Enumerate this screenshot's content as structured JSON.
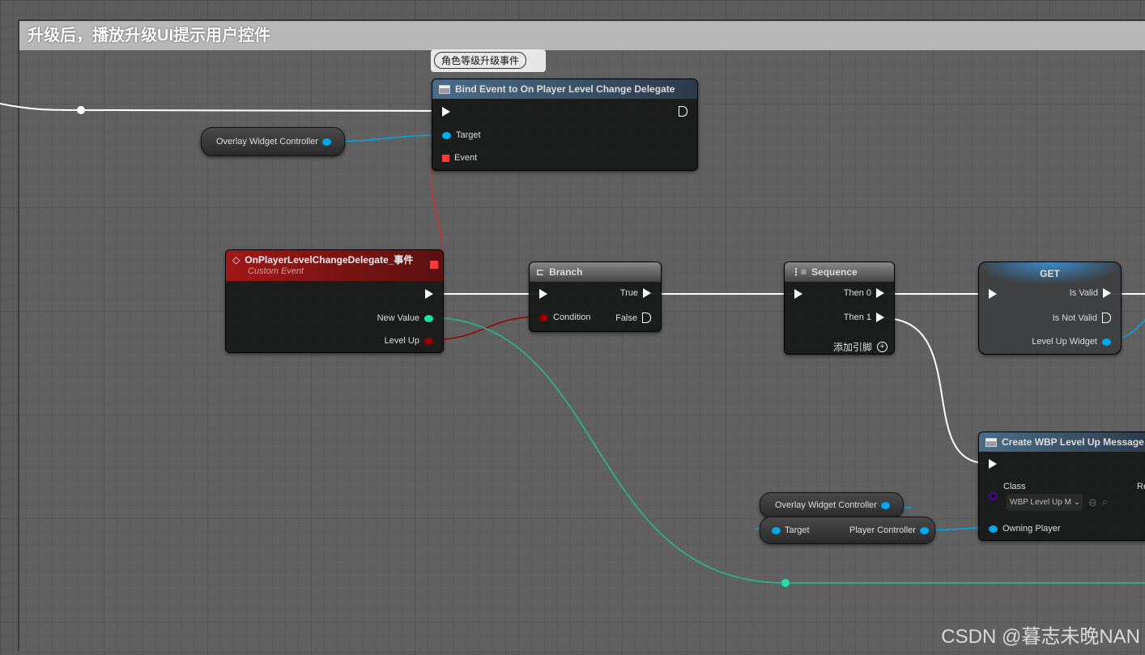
{
  "comment": {
    "title": "升级后，播放升级UI提示用户控件"
  },
  "bubble": {
    "text": "角色等级升级事件"
  },
  "bind_node": {
    "title": "Bind Event to On Player Level Change Delegate",
    "pins": {
      "target": "Target",
      "event": "Event"
    }
  },
  "overlay_1": {
    "label": "Overlay Widget Controller"
  },
  "event_node": {
    "title": "OnPlayerLevelChangeDelegate_事件",
    "subtitle": "Custom Event",
    "pins": {
      "new_value": "New Value",
      "level_up": "Level Up"
    }
  },
  "branch": {
    "title": "Branch",
    "pins": {
      "true": "True",
      "false": "False",
      "condition": "Condition"
    }
  },
  "sequence": {
    "title": "Sequence",
    "pins": {
      "then0": "Then 0",
      "then1": "Then 1",
      "add": "添加引脚"
    }
  },
  "get_node": {
    "title": "GET",
    "pins": {
      "is_valid": "Is Valid",
      "is_not_valid": "Is Not Valid",
      "widget": "Level Up Widget"
    }
  },
  "create_node": {
    "title": "Create WBP Level Up Message",
    "pins": {
      "class": "Class",
      "class_value": "WBP Level Up M",
      "return": "Re",
      "owning": "Owning Player"
    }
  },
  "overlay_2": {
    "label": "Overlay Widget Controller"
  },
  "player_ctrl": {
    "target": "Target",
    "label": "Player Controller"
  },
  "watermark": "CSDN @暮志未晚NAN",
  "colors": {
    "exec": "#ffffff",
    "object": "#00a8f0",
    "delegate": "#ff3838",
    "int": "#1fe0a8",
    "bool": "#950000",
    "class": "#5800a8"
  }
}
